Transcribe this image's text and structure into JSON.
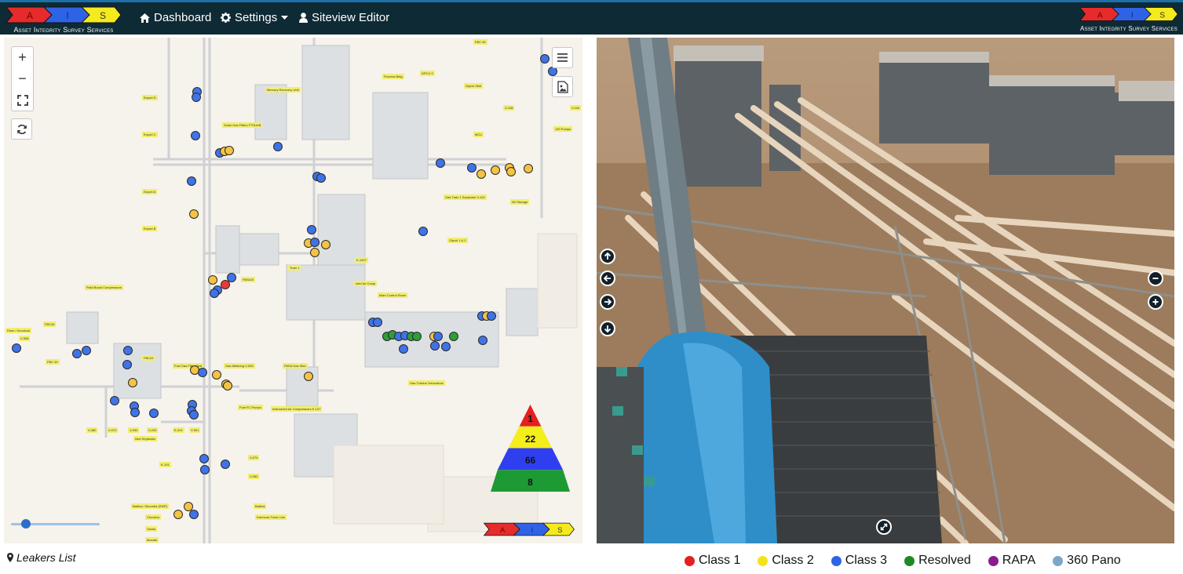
{
  "brand": {
    "logo_letters": [
      "A",
      "I",
      "S"
    ],
    "logo_subtitle": "Asset Integrity Survey Services",
    "colors": {
      "red": "#e52b2b",
      "blue": "#2f63e6",
      "yellow": "#f4ea1d",
      "navbar": "#0e2a35"
    }
  },
  "nav": {
    "dashboard": {
      "label": "Dashboard",
      "icon": "home-icon"
    },
    "settings": {
      "label": "Settings",
      "icon": "gear-icon"
    },
    "siteview": {
      "label": "Siteview Editor",
      "icon": "user-icon"
    }
  },
  "map": {
    "labels": [
      "Export D",
      "Export C",
      "Export A",
      "Export B",
      "Solas Gas Filters FT01A/B",
      "Mercury Recovery Unit",
      "Process Bldg",
      "DPCU 2",
      "Glycol Skid",
      "FBC 45",
      "V-108",
      "V-116",
      "120 Pumps",
      "MCU",
      "Gas Train 1 Separator V-101",
      "N2 Storage",
      "Glycol 1 & 2",
      "K-1407",
      "Train 1",
      "Field Boost Compressors",
      "PASA B",
      "Inlet Air Comp",
      "Main Control Room",
      "Flare / Knockout",
      "V-908",
      "FBC49",
      "FBC 49",
      "FBC43",
      "Fuel Gas Filter Skid",
      "Gas Metering V-909",
      "PASA Gas Skid",
      "Fuel FC Pumps",
      "Instrument Air Compressors K-107",
      "Gas Turbine Generators",
      "V-080",
      "V-070",
      "V-090",
      "V-230",
      "E-201",
      "V-901",
      "Inlet Separator",
      "K-101",
      "V-074",
      "V-050",
      "Ballera / Moomba (SWP)",
      "Ballera",
      "Chookoo",
      "Karmona Trunk Line",
      "Yanna",
      "Mumah"
    ],
    "zoom_in": "+",
    "zoom_out": "−",
    "pyramid": {
      "class1": "1",
      "class2": "22",
      "class3": "66",
      "resolved": "8"
    }
  },
  "footer": {
    "leakers_list": "Leakers List",
    "legend": [
      {
        "label": "Class 1",
        "color": "#e51f1f"
      },
      {
        "label": "Class 2",
        "color": "#f4e21c"
      },
      {
        "label": "Class 3",
        "color": "#2f63e6"
      },
      {
        "label": "Resolved",
        "color": "#1e8a25"
      },
      {
        "label": "RAPA",
        "color": "#8a1a8e"
      },
      {
        "label": "360 Pano",
        "color": "#7aa7c9"
      }
    ]
  }
}
